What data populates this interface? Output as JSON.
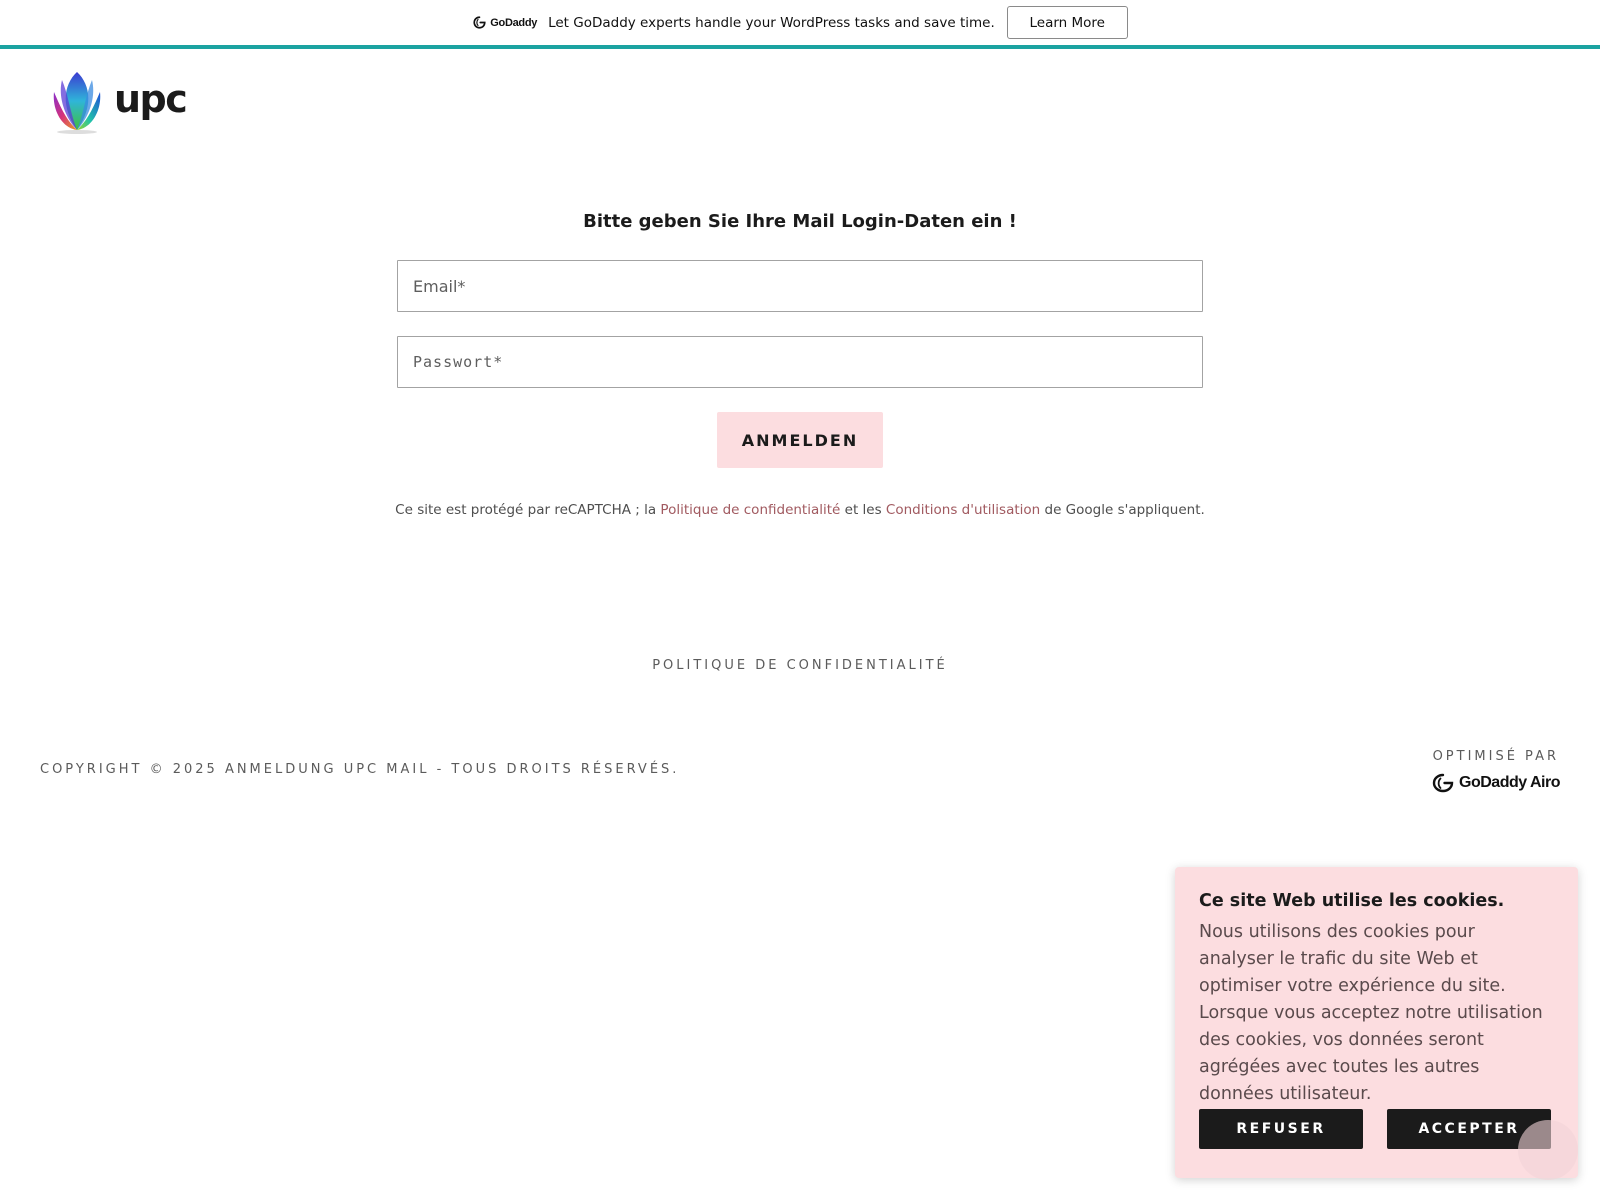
{
  "promo": {
    "logo_text": "GoDaddy",
    "message": "Let GoDaddy experts handle your WordPress tasks and save time.",
    "button_label": "Learn More"
  },
  "header": {
    "logo_text": "upc"
  },
  "login": {
    "title": "Bitte geben Sie Ihre Mail Login-Daten ein !",
    "email_placeholder": "Email*",
    "password_placeholder": "Passwort*",
    "submit_label": "ANMELDEN",
    "recaptcha_prefix": "Ce site est protégé par reCAPTCHA ; la ",
    "privacy_link": "Politique de confidentialité",
    "recaptcha_middle": " et les ",
    "terms_link": "Conditions d'utilisation",
    "recaptcha_suffix": " de Google s'appliquent."
  },
  "footer": {
    "privacy_link": "POLITIQUE DE CONFIDENTIALITÉ",
    "copyright": "COPYRIGHT © 2025 ANMELDUNG UPC MAIL - TOUS DROITS RÉSERVÉS.",
    "powered_by": "OPTIMISÉ PAR",
    "powered_logo_text": "GoDaddy Airo"
  },
  "cookie_banner": {
    "title": "Ce site Web utilise les cookies.",
    "text": "Nous utilisons des cookies pour analyser le trafic du site Web et optimiser votre expérience du site. Lorsque vous acceptez notre utilisation des cookies, vos données seront agrégées avec toutes les autres données utilisateur.",
    "refuse_label": "REFUSER",
    "accept_label": "ACCEPTER"
  },
  "colors": {
    "accent_bar": "#1ba3a1",
    "pink_background": "#fcdde0",
    "link_color": "#a15a60",
    "dark_button": "#1b1b1b"
  },
  "icons": {
    "promo_logo": "godaddy-icon",
    "brand_logo": "upc-flower-icon",
    "powered_logo": "godaddy-airo-icon"
  }
}
